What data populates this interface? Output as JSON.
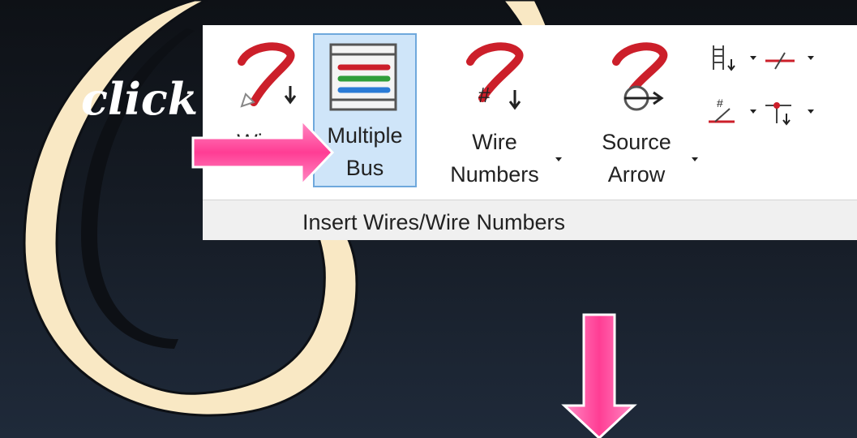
{
  "annotation": {
    "click_text": "click"
  },
  "ribbon": {
    "group_label": "Insert Wires/Wire Numbers",
    "buttons": [
      {
        "id": "wire",
        "label_line1": "Wire",
        "label_line2": "",
        "icon": "wire-icon"
      },
      {
        "id": "multiple_bus",
        "label_line1": "Multiple",
        "label_line2": "Bus",
        "icon": "multiple-bus-icon",
        "selected": true
      },
      {
        "id": "wire_numbers",
        "label_line1": "Wire",
        "label_line2": "Numbers",
        "icon": "wire-numbers-icon",
        "has_dropdown": true
      },
      {
        "id": "source_arrow",
        "label_line1": "Source",
        "label_line2": "Arrow",
        "icon": "source-arrow-icon",
        "has_dropdown": true
      }
    ],
    "small_tools": [
      "ladder-icon",
      "cross-wire-icon",
      "wire-number-leader-icon",
      "tee-marker-icon"
    ]
  },
  "colors": {
    "swirl": "#f9e8c4",
    "pink_arrow": "#ff4fa0",
    "wire_red": "#cc1f2a",
    "selection": "#cfe5f9"
  }
}
